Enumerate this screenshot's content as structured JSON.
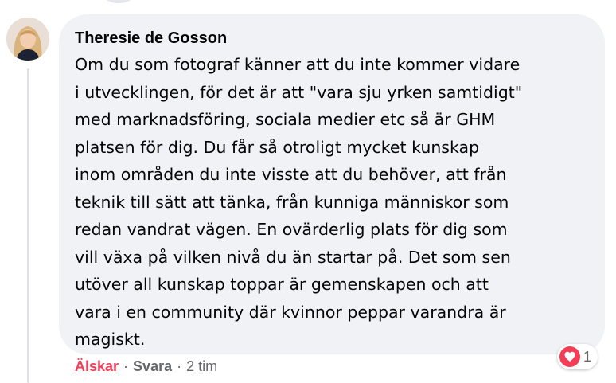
{
  "comment": {
    "author": "Theresie de Gosson",
    "lines": [
      "Om du som fotograf känner att du inte kommer vidare",
      "i utvecklingen, för det är att \"vara sju yrken samtidigt\"",
      "med marknadsföring, sociala medier etc så är GHM",
      "platsen för dig. Du får så otroligt mycket kunskap",
      "inom områden du inte visste att du behöver, att från",
      "teknik till sätt att tänka, från kunniga människor som",
      "redan vandrat vägen. En ovärderlig plats för dig som",
      "vill växa på vilken nivå du än startar på. Det som sen",
      "utöver all kunskap toppar är gemenskapen och att",
      "vara i en community där kvinnor peppar varandra är",
      "magiskt."
    ]
  },
  "reactions": {
    "icon": "heart-icon",
    "count": "1"
  },
  "actions": {
    "love_label": "Älskar",
    "separator": "·",
    "reply_label": "Svara",
    "timestamp": "2 tim"
  },
  "colors": {
    "bubble_bg": "#f0f2f5",
    "love_red": "#f33e58",
    "meta_gray": "#65676b",
    "text": "#050505"
  }
}
